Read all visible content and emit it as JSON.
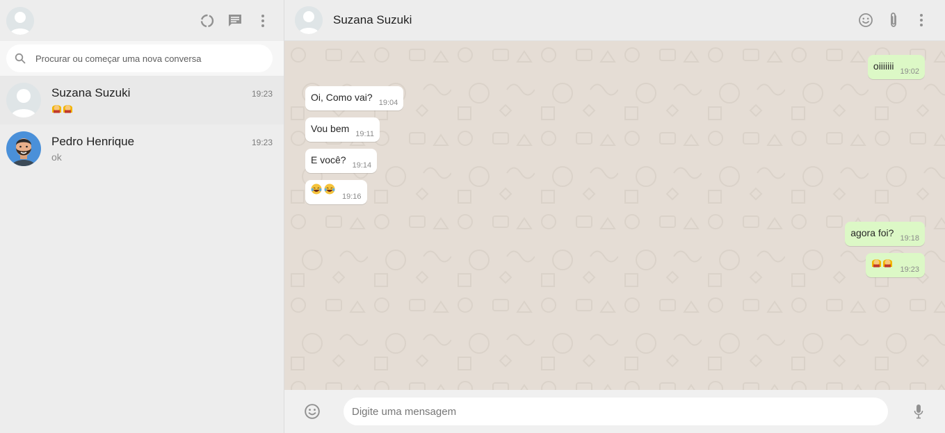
{
  "sidebar": {
    "search": {
      "placeholder": "Procurar ou começar uma nova conversa"
    },
    "chats": [
      {
        "name": "Suzana Suzuki",
        "time": "19:23",
        "last_message_icons": "two-person-emoji-icon",
        "active": true
      },
      {
        "name": "Pedro Henrique",
        "time": "19:23",
        "last_message": "ok",
        "active": false
      }
    ]
  },
  "conversation": {
    "contact_name": "Suzana Suzuki",
    "messages": [
      {
        "direction": "out",
        "text": "oiiiiiii",
        "time": "19:02"
      },
      {
        "direction": "in",
        "text": "Oi, Como vai?",
        "time": "19:04"
      },
      {
        "direction": "in",
        "text": "Vou bem",
        "time": "19:11"
      },
      {
        "direction": "in",
        "text": "E você?",
        "time": "19:14"
      },
      {
        "direction": "in",
        "text": "",
        "emoji": "laughing-tears-emoji-icon",
        "time": "19:16"
      },
      {
        "direction": "out",
        "text": "agora foi?",
        "time": "19:18"
      },
      {
        "direction": "out",
        "text": "",
        "emoji": "two-person-emoji-icon",
        "time": "19:23"
      }
    ]
  },
  "composer": {
    "placeholder": "Digite uma mensagem"
  },
  "colors": {
    "sidebar_bg": "#ededed",
    "chat_bg": "#e5ddd5",
    "outgoing_bubble": "#dcf8c6",
    "incoming_bubble": "#ffffff",
    "icon": "#919191"
  }
}
